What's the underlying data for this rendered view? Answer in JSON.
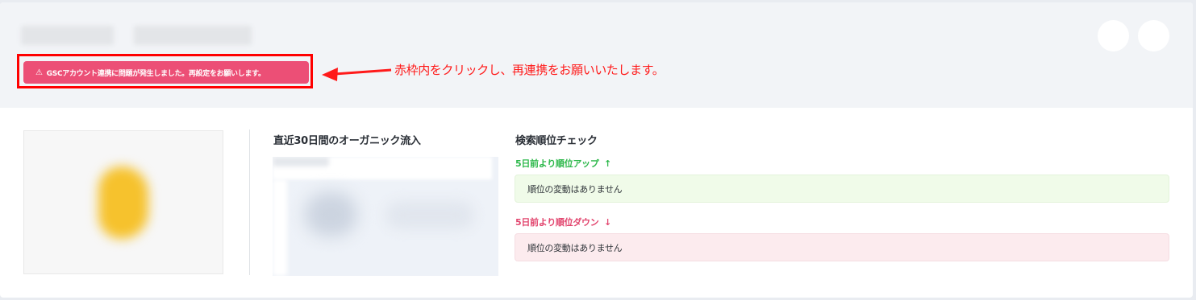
{
  "header": {
    "alert_icon": "⚠",
    "alert_button_label": "GSCアカウント連携に問題が発生しました。再設定をお願いします。",
    "annotation_text": "赤枠内をクリックし、再連携をお願いいたします。",
    "highlight_color": "#ff0000",
    "alert_color": "#ec4f76"
  },
  "organic": {
    "title": "直近30日間のオーガニック流入"
  },
  "ranking": {
    "title": "検索順位チェック",
    "up_label": "5日前より順位アップ",
    "up_arrow": "↑",
    "up_message": "順位の変動はありません",
    "down_label": "5日前より順位ダウン",
    "down_arrow": "↓",
    "down_message": "順位の変動はありません",
    "up_color": "#2db84b",
    "down_color": "#e2456e"
  }
}
